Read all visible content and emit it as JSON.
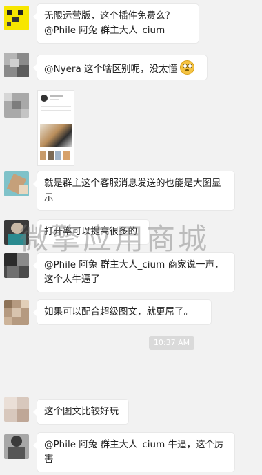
{
  "messages": [
    {
      "text": "无限运营版，这个插件免费么？\n@Phile 阿兔 群主大人_cium"
    },
    {
      "text": "@Nyera 这个啥区别呢，没太懂"
    },
    {
      "text": "就是群主这个客服消息发送的也能是大图显示"
    },
    {
      "text": "打开率可以提高很多的"
    },
    {
      "text": "@Phile 阿兔 群主大人_cium 商家说一声，这个太牛逼了"
    },
    {
      "text": "如果可以配合超级图文，就更屌了。"
    },
    {
      "text": "这个图文比较好玩"
    },
    {
      "text": "@Phile 阿兔 群主大人_cium 牛逼，这个厉害"
    }
  ],
  "timestamp": "10:37 AM",
  "watermark": "微擎应用商城",
  "colors": {
    "bubble": "#ffffff",
    "background": "#f2f2f2",
    "accent_avatar": "#f7e600"
  }
}
